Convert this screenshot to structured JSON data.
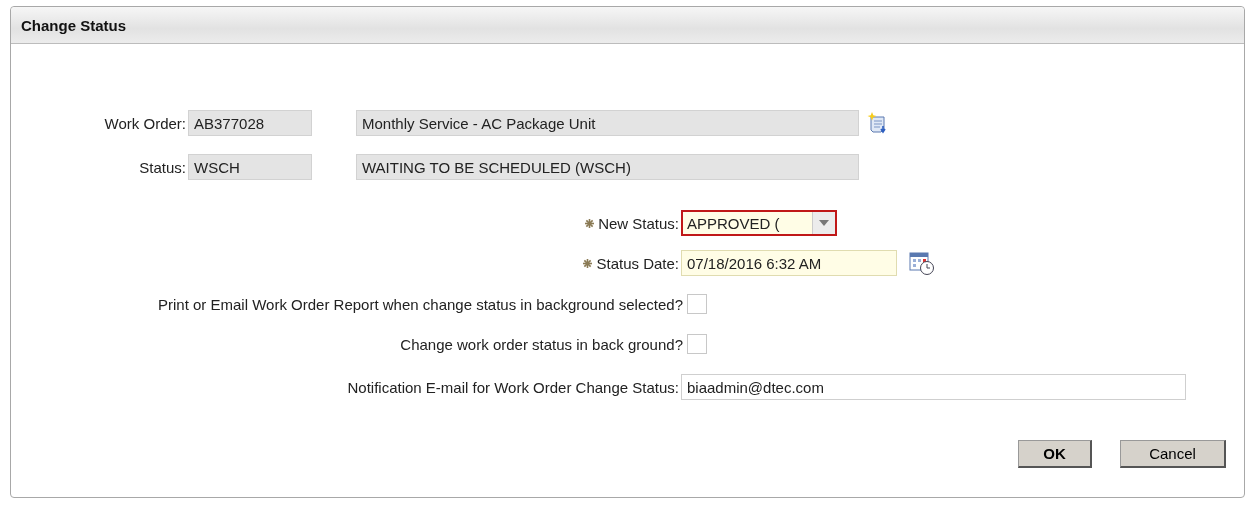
{
  "dialog": {
    "title": "Change Status"
  },
  "work_order": {
    "label": "Work Order:",
    "code": "AB377028",
    "description": "Monthly Service - AC Package Unit"
  },
  "status": {
    "label": "Status:",
    "code": "WSCH",
    "description": "WAITING TO BE SCHEDULED (WSCH)"
  },
  "new_status": {
    "label": "New Status:",
    "required": true,
    "value": "APPROVED (",
    "invalid": true
  },
  "status_date": {
    "label": "Status Date:",
    "required": true,
    "value": "07/18/2016 6:32 AM"
  },
  "options": [
    {
      "label": "Print or Email Work Order Report when change status in background selected?",
      "checked": false
    },
    {
      "label": "Change work order status in back ground?",
      "checked": false
    }
  ],
  "notification_email": {
    "label": "Notification E-mail for Work Order Change Status:",
    "value": "biaadmin@dtec.com"
  },
  "buttons": [
    {
      "label": "OK",
      "default": true
    },
    {
      "label": "Cancel",
      "default": false
    }
  ]
}
